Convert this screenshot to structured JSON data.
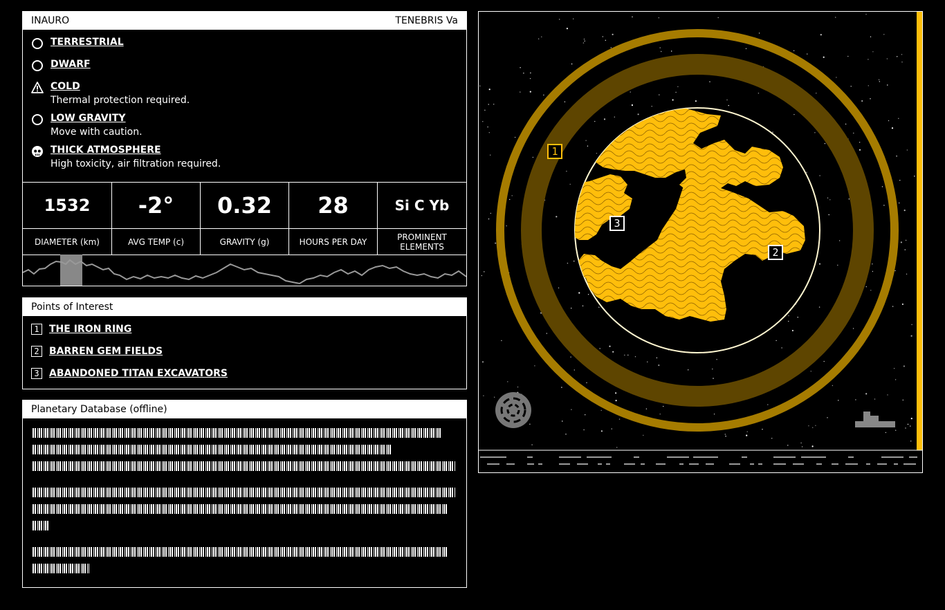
{
  "planet": {
    "name": "INAURO",
    "system": "TENEBRIS Va"
  },
  "traits": [
    {
      "icon": "circle-icon",
      "title": "TERRESTRIAL",
      "desc": ""
    },
    {
      "icon": "circle-icon",
      "title": "DWARF",
      "desc": ""
    },
    {
      "icon": "warning-icon",
      "title": "COLD",
      "desc": "Thermal protection required."
    },
    {
      "icon": "circle-icon",
      "title": "LOW GRAVITY",
      "desc": "Move with caution."
    },
    {
      "icon": "skull-icon",
      "title": "THICK ATMOSPHERE",
      "desc": "High toxicity, air filtration required."
    }
  ],
  "stats": [
    {
      "value": "1532",
      "label": "DIAMETER (km)"
    },
    {
      "value": "-2°",
      "label": "AVG TEMP (c)"
    },
    {
      "value": "0.32",
      "label": "GRAVITY (g)"
    },
    {
      "value": "28",
      "label": "HOURS PER DAY"
    },
    {
      "value": "Si C Yb",
      "label": "PROMINENT ELEMENTS"
    }
  ],
  "poi": {
    "title": "Points of Interest",
    "items": [
      {
        "num": "1",
        "label": "THE IRON RING"
      },
      {
        "num": "2",
        "label": "BARREN GEM FIELDS"
      },
      {
        "num": "3",
        "label": "ABANDONED TITAN EXCAVATORS"
      }
    ]
  },
  "database": {
    "title": "Planetary Database (offline)"
  },
  "map": {
    "markers": [
      "1",
      "2",
      "3"
    ]
  },
  "colors": {
    "accent": "#ffbe0b",
    "ring": "#a67c00",
    "ring_dark": "#5e4500"
  }
}
